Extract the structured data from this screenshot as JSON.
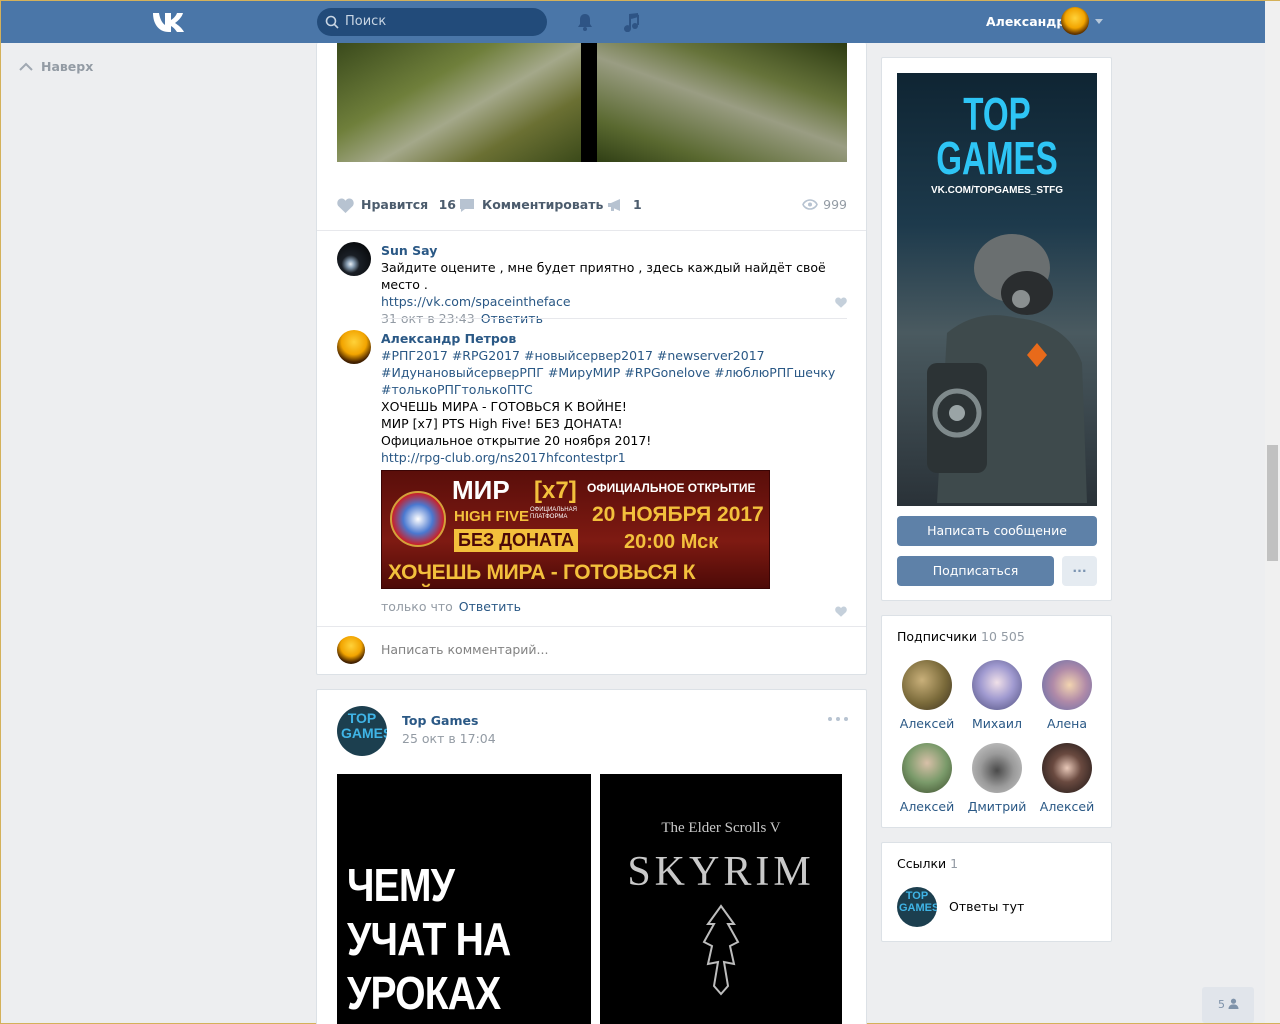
{
  "header": {
    "search_placeholder": "Поиск",
    "user_name": "Александр",
    "icons": {
      "logo": "vk-logo-icon",
      "search": "search-icon",
      "notifications": "bell-icon",
      "music": "music-note-icon",
      "menu": "chevron-down-icon"
    },
    "colors": {
      "bar": "#4a76a8",
      "search_bg": "#224b7a"
    }
  },
  "sidebar": {
    "to_top_label": "Наверх"
  },
  "post1": {
    "like_label": "Нравится",
    "like_count": "16",
    "comment_label": "Комментировать",
    "share_count": "1",
    "views": "999",
    "comments": [
      {
        "author": "Sun Say",
        "text": "Зайдите оцените , мне будет приятно , здесь каждый найдёт своё место .",
        "link": "https://vk.com/spaceintheface",
        "date": "31 окт в 23:43",
        "reply_label": "Ответить"
      },
      {
        "author": "Александр Петров",
        "hashtags_line1": "#РПГ2017 #RPG2017 #новыйсервер2017 #newserver2017",
        "hashtags_line2": "#ИдунановыйсерверРПГ #МируМИР #RPGonelove #люблюРПГшечку",
        "hashtags_line3": "#толькоРПГтолькоПТС",
        "line1": "ХОЧЕШЬ МИРА - ГОТОВЬСЯ К ВОЙНЕ!",
        "line2": "МИР [x7] PTS High Five! БЕЗ ДОНАТА!",
        "line3": "Официальное открытие 20 ноября 2017!",
        "link": "http://rpg-club.org/ns2017hfcontestpr1",
        "date": "только что",
        "reply_label": "Ответить",
        "banner": {
          "title": "МИР",
          "rate": "[x7]",
          "chronicle": "HIGH FIVE",
          "platform": "ОФИЦИАЛЬНАЯ ПЛАТФОРМА",
          "no_donate": "БЕЗ ДОНАТА",
          "opening": "ОФИЦИАЛЬНОЕ ОТКРЫТИЕ",
          "date": "20 НОЯБРЯ 2017",
          "time": "20:00 Мск",
          "slogan": "ХОЧЕШЬ МИРА - ГОТОВЬСЯ К ВОЙНЕ"
        }
      }
    ],
    "write_comment_placeholder": "Написать комментарий..."
  },
  "post2": {
    "author": "Top Games",
    "date": "25 окт в 17:04",
    "avatar_text": "TOP GAMES",
    "image1_text": "ЧЕМУ УЧАТ НА УРОКАХ",
    "image2_subtitle": "The Elder Scrolls V",
    "image2_title": "SKYRIM"
  },
  "community": {
    "poster_title1": "TOP",
    "poster_title2": "GAMES",
    "poster_url": "VK.COM/TOPGAMES_STFG",
    "message_button": "Написать сообщение",
    "subscribe_button": "Подписаться",
    "more_button": "···"
  },
  "subscribers": {
    "title": "Подписчики",
    "count": "10 505",
    "people": [
      {
        "name": "Алексей",
        "color": "#7a6a3a"
      },
      {
        "name": "Михаил",
        "color": "#6a6aa8"
      },
      {
        "name": "Алена",
        "color": "#8a7aa0"
      },
      {
        "name": "Алексей",
        "color": "#5a7a4a"
      },
      {
        "name": "Дмитрий",
        "color": "#8a8a8a"
      },
      {
        "name": "Алексей",
        "color": "#3a3030"
      }
    ]
  },
  "links": {
    "title": "Ссылки",
    "count": "1",
    "items": [
      {
        "label": "Ответы тут",
        "avatar_text": "TOP GAMES"
      }
    ]
  },
  "online_badge": {
    "count": "5"
  }
}
